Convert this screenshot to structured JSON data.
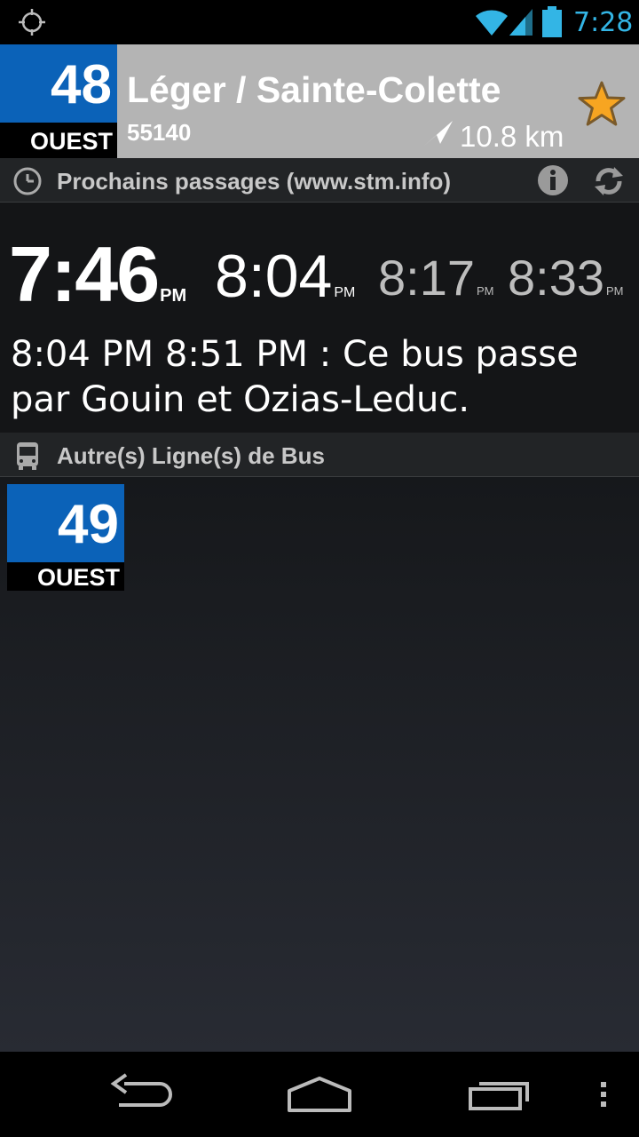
{
  "status_bar": {
    "time": "7:28",
    "icons": [
      "location-icon",
      "wifi-icon",
      "signal-icon",
      "battery-icon"
    ],
    "accent": "#33b5e5"
  },
  "header": {
    "route_number": "48",
    "direction": "OUEST",
    "stop_name": "Léger / Sainte-Colette",
    "stop_code": "55140",
    "distance": "10.8 km",
    "route_color": "#0b62b8",
    "favorite": true
  },
  "next_passes": {
    "section_label": "Prochains passages (www.stm.info)",
    "times": [
      {
        "time": "7:46",
        "ampm": "PM"
      },
      {
        "time": "8:04",
        "ampm": "PM"
      },
      {
        "time": "8:17",
        "ampm": "PM"
      },
      {
        "time": "8:33",
        "ampm": "PM"
      }
    ],
    "notice": "8:04 PM 8:51 PM : Ce bus passe par Gouin et Ozias-Leduc."
  },
  "other_routes": {
    "section_label": "Autre(s) Ligne(s) de Bus",
    "routes": [
      {
        "number": "49",
        "direction": "OUEST"
      }
    ]
  },
  "nav_bar": {
    "icons": [
      "back-icon",
      "home-icon",
      "recent-apps-icon",
      "overflow-menu-icon"
    ]
  }
}
